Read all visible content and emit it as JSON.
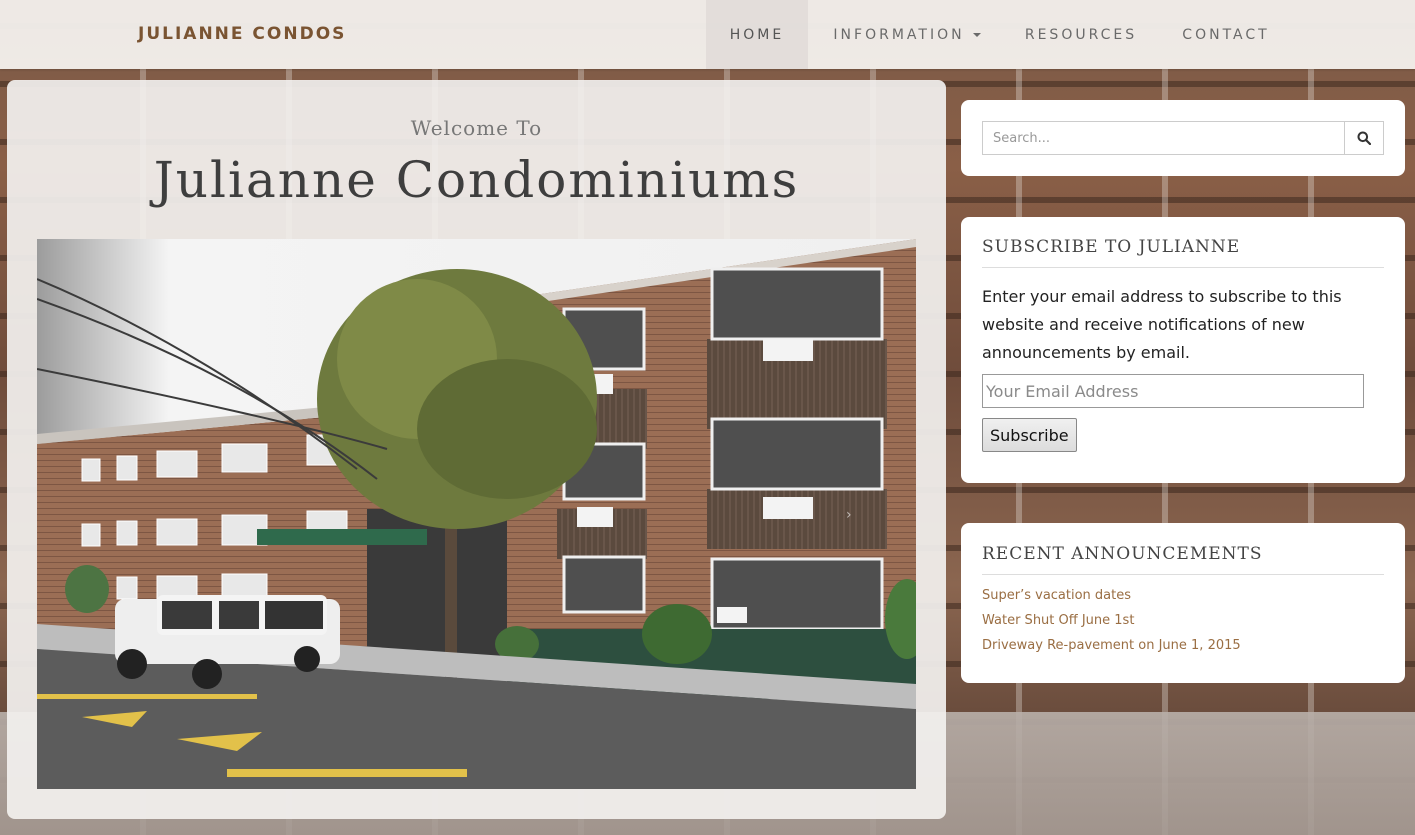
{
  "navbar": {
    "brand": "JULIANNE CONDOS",
    "items": [
      {
        "label": "HOME",
        "active": true
      },
      {
        "label": "INFORMATION",
        "has_dropdown": true
      },
      {
        "label": "RESOURCES"
      },
      {
        "label": "CONTACT"
      }
    ]
  },
  "main": {
    "welcome": "Welcome To",
    "title": "Julianne Condominiums",
    "slider_next": "›"
  },
  "sidebar": {
    "search": {
      "placeholder": "Search...",
      "icon": "search-icon"
    },
    "subscribe": {
      "title": "SUBSCRIBE TO JULIANNE",
      "text": "Enter your email address to subscribe to this website and receive notifications of new announcements by email.",
      "email_placeholder": "Your Email Address",
      "button": "Subscribe"
    },
    "announcements": {
      "title": "RECENT ANNOUNCEMENTS",
      "items": [
        "Super’s vacation dates",
        "Water Shut Off June 1st",
        "Driveway Re-pavement on June 1, 2015"
      ]
    }
  },
  "colors": {
    "brand": "#7a5432",
    "link": "#9a6e43",
    "nav_text": "#6a6a6a"
  }
}
